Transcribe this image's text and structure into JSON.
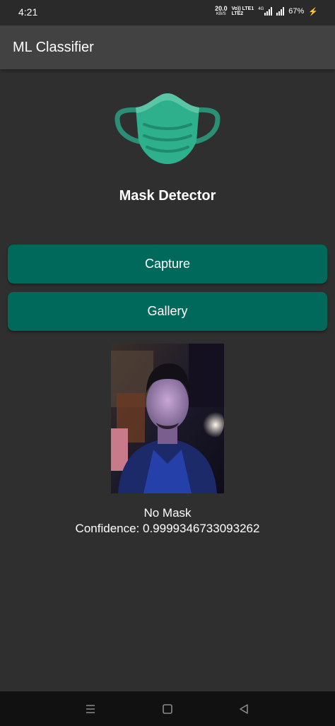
{
  "status_bar": {
    "time": "4:21",
    "net_speed_value": "20.0",
    "net_speed_unit": "KB/S",
    "volte_line1": "Vo)) LTE1",
    "volte_line2": "LTE2",
    "network_type": "4G",
    "battery": "67%"
  },
  "app_bar": {
    "title": "ML Classifier"
  },
  "main": {
    "icon": "face-mask-icon",
    "heading": "Mask Detector",
    "capture_label": "Capture",
    "gallery_label": "Gallery",
    "result_label": "No Mask",
    "confidence_text": "Confidence: 0.9999346733093262"
  },
  "nav_bar": {
    "icons": [
      "menu-icon",
      "home-icon",
      "back-icon"
    ]
  },
  "colors": {
    "background": "#2f2f2f",
    "app_bar": "#424242",
    "button": "#00695c",
    "mask": "#2fb08d"
  }
}
